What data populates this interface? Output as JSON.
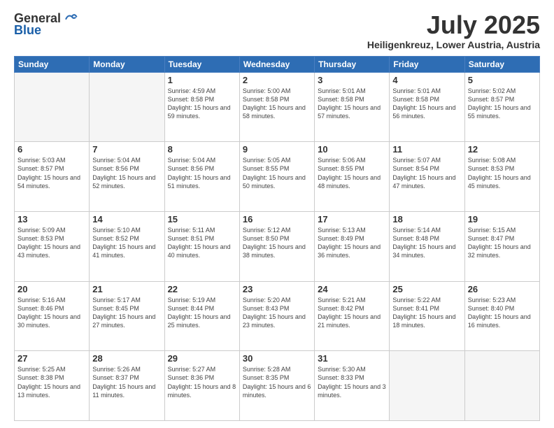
{
  "header": {
    "logo_general": "General",
    "logo_blue": "Blue",
    "title": "July 2025",
    "subtitle": "Heiligenkreuz, Lower Austria, Austria"
  },
  "weekdays": [
    "Sunday",
    "Monday",
    "Tuesday",
    "Wednesday",
    "Thursday",
    "Friday",
    "Saturday"
  ],
  "weeks": [
    [
      {
        "day": "",
        "sunrise": "",
        "sunset": "",
        "daylight": ""
      },
      {
        "day": "",
        "sunrise": "",
        "sunset": "",
        "daylight": ""
      },
      {
        "day": "1",
        "sunrise": "Sunrise: 4:59 AM",
        "sunset": "Sunset: 8:58 PM",
        "daylight": "Daylight: 15 hours and 59 minutes."
      },
      {
        "day": "2",
        "sunrise": "Sunrise: 5:00 AM",
        "sunset": "Sunset: 8:58 PM",
        "daylight": "Daylight: 15 hours and 58 minutes."
      },
      {
        "day": "3",
        "sunrise": "Sunrise: 5:01 AM",
        "sunset": "Sunset: 8:58 PM",
        "daylight": "Daylight: 15 hours and 57 minutes."
      },
      {
        "day": "4",
        "sunrise": "Sunrise: 5:01 AM",
        "sunset": "Sunset: 8:58 PM",
        "daylight": "Daylight: 15 hours and 56 minutes."
      },
      {
        "day": "5",
        "sunrise": "Sunrise: 5:02 AM",
        "sunset": "Sunset: 8:57 PM",
        "daylight": "Daylight: 15 hours and 55 minutes."
      }
    ],
    [
      {
        "day": "6",
        "sunrise": "Sunrise: 5:03 AM",
        "sunset": "Sunset: 8:57 PM",
        "daylight": "Daylight: 15 hours and 54 minutes."
      },
      {
        "day": "7",
        "sunrise": "Sunrise: 5:04 AM",
        "sunset": "Sunset: 8:56 PM",
        "daylight": "Daylight: 15 hours and 52 minutes."
      },
      {
        "day": "8",
        "sunrise": "Sunrise: 5:04 AM",
        "sunset": "Sunset: 8:56 PM",
        "daylight": "Daylight: 15 hours and 51 minutes."
      },
      {
        "day": "9",
        "sunrise": "Sunrise: 5:05 AM",
        "sunset": "Sunset: 8:55 PM",
        "daylight": "Daylight: 15 hours and 50 minutes."
      },
      {
        "day": "10",
        "sunrise": "Sunrise: 5:06 AM",
        "sunset": "Sunset: 8:55 PM",
        "daylight": "Daylight: 15 hours and 48 minutes."
      },
      {
        "day": "11",
        "sunrise": "Sunrise: 5:07 AM",
        "sunset": "Sunset: 8:54 PM",
        "daylight": "Daylight: 15 hours and 47 minutes."
      },
      {
        "day": "12",
        "sunrise": "Sunrise: 5:08 AM",
        "sunset": "Sunset: 8:53 PM",
        "daylight": "Daylight: 15 hours and 45 minutes."
      }
    ],
    [
      {
        "day": "13",
        "sunrise": "Sunrise: 5:09 AM",
        "sunset": "Sunset: 8:53 PM",
        "daylight": "Daylight: 15 hours and 43 minutes."
      },
      {
        "day": "14",
        "sunrise": "Sunrise: 5:10 AM",
        "sunset": "Sunset: 8:52 PM",
        "daylight": "Daylight: 15 hours and 41 minutes."
      },
      {
        "day": "15",
        "sunrise": "Sunrise: 5:11 AM",
        "sunset": "Sunset: 8:51 PM",
        "daylight": "Daylight: 15 hours and 40 minutes."
      },
      {
        "day": "16",
        "sunrise": "Sunrise: 5:12 AM",
        "sunset": "Sunset: 8:50 PM",
        "daylight": "Daylight: 15 hours and 38 minutes."
      },
      {
        "day": "17",
        "sunrise": "Sunrise: 5:13 AM",
        "sunset": "Sunset: 8:49 PM",
        "daylight": "Daylight: 15 hours and 36 minutes."
      },
      {
        "day": "18",
        "sunrise": "Sunrise: 5:14 AM",
        "sunset": "Sunset: 8:48 PM",
        "daylight": "Daylight: 15 hours and 34 minutes."
      },
      {
        "day": "19",
        "sunrise": "Sunrise: 5:15 AM",
        "sunset": "Sunset: 8:47 PM",
        "daylight": "Daylight: 15 hours and 32 minutes."
      }
    ],
    [
      {
        "day": "20",
        "sunrise": "Sunrise: 5:16 AM",
        "sunset": "Sunset: 8:46 PM",
        "daylight": "Daylight: 15 hours and 30 minutes."
      },
      {
        "day": "21",
        "sunrise": "Sunrise: 5:17 AM",
        "sunset": "Sunset: 8:45 PM",
        "daylight": "Daylight: 15 hours and 27 minutes."
      },
      {
        "day": "22",
        "sunrise": "Sunrise: 5:19 AM",
        "sunset": "Sunset: 8:44 PM",
        "daylight": "Daylight: 15 hours and 25 minutes."
      },
      {
        "day": "23",
        "sunrise": "Sunrise: 5:20 AM",
        "sunset": "Sunset: 8:43 PM",
        "daylight": "Daylight: 15 hours and 23 minutes."
      },
      {
        "day": "24",
        "sunrise": "Sunrise: 5:21 AM",
        "sunset": "Sunset: 8:42 PM",
        "daylight": "Daylight: 15 hours and 21 minutes."
      },
      {
        "day": "25",
        "sunrise": "Sunrise: 5:22 AM",
        "sunset": "Sunset: 8:41 PM",
        "daylight": "Daylight: 15 hours and 18 minutes."
      },
      {
        "day": "26",
        "sunrise": "Sunrise: 5:23 AM",
        "sunset": "Sunset: 8:40 PM",
        "daylight": "Daylight: 15 hours and 16 minutes."
      }
    ],
    [
      {
        "day": "27",
        "sunrise": "Sunrise: 5:25 AM",
        "sunset": "Sunset: 8:38 PM",
        "daylight": "Daylight: 15 hours and 13 minutes."
      },
      {
        "day": "28",
        "sunrise": "Sunrise: 5:26 AM",
        "sunset": "Sunset: 8:37 PM",
        "daylight": "Daylight: 15 hours and 11 minutes."
      },
      {
        "day": "29",
        "sunrise": "Sunrise: 5:27 AM",
        "sunset": "Sunset: 8:36 PM",
        "daylight": "Daylight: 15 hours and 8 minutes."
      },
      {
        "day": "30",
        "sunrise": "Sunrise: 5:28 AM",
        "sunset": "Sunset: 8:35 PM",
        "daylight": "Daylight: 15 hours and 6 minutes."
      },
      {
        "day": "31",
        "sunrise": "Sunrise: 5:30 AM",
        "sunset": "Sunset: 8:33 PM",
        "daylight": "Daylight: 15 hours and 3 minutes."
      },
      {
        "day": "",
        "sunrise": "",
        "sunset": "",
        "daylight": ""
      },
      {
        "day": "",
        "sunrise": "",
        "sunset": "",
        "daylight": ""
      }
    ]
  ]
}
